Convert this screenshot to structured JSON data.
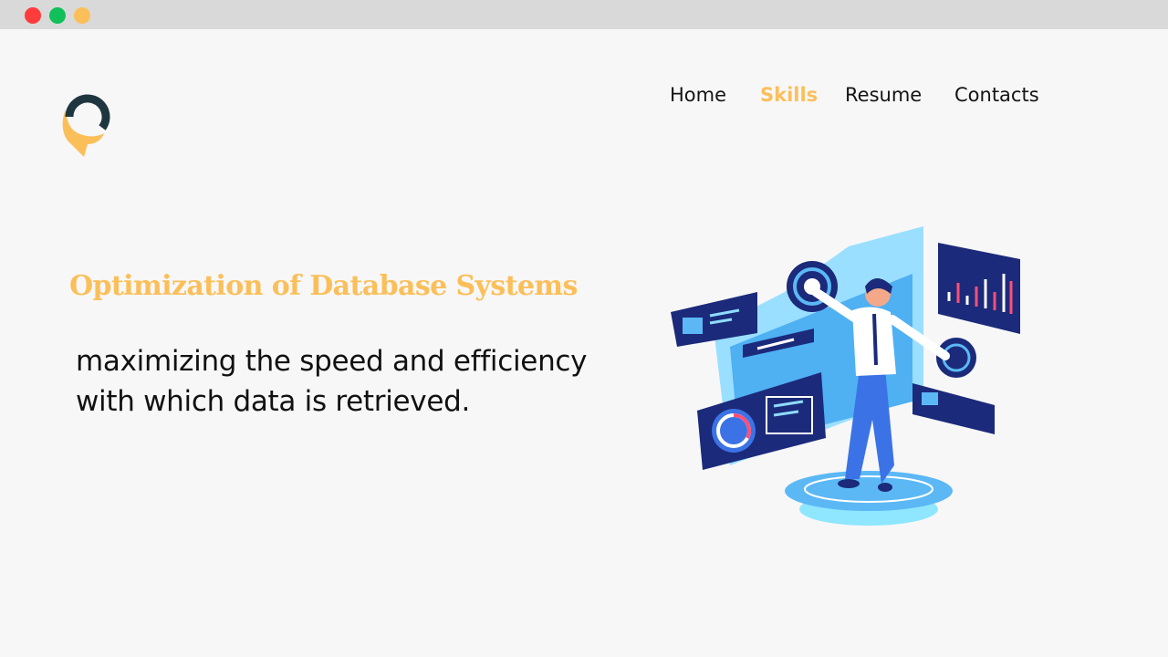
{
  "window": {
    "controls": [
      "close",
      "minimize",
      "maximize"
    ],
    "colors": {
      "close": "#ff3b3b",
      "minimize": "#12c05a",
      "maximize": "#fbbf5a",
      "titlebar": "#d9d9d9"
    }
  },
  "brand": {
    "logo_icon": "map-pin-chat-icon",
    "colors": {
      "dark": "#1f3640",
      "accent": "#fbbf5a"
    }
  },
  "nav": {
    "items": [
      {
        "label": "Home",
        "active": false
      },
      {
        "label": "Skills",
        "active": true
      },
      {
        "label": "Resume",
        "active": false
      },
      {
        "label": "Contacts",
        "active": false
      }
    ],
    "active_color": "#fbbf5a"
  },
  "hero": {
    "title": "Optimization of Database Systems",
    "description_line1": "maximizing the speed and efficiency",
    "description_line2": "with which data is retrieved.",
    "illustration": "person-interacting-with-data-dashboards-illustration"
  },
  "colors": {
    "background": "#f7f7f7",
    "text": "#111111",
    "accent": "#fbbf5a",
    "navy": "#1b2a7a",
    "sky": "#5bb8f5"
  }
}
